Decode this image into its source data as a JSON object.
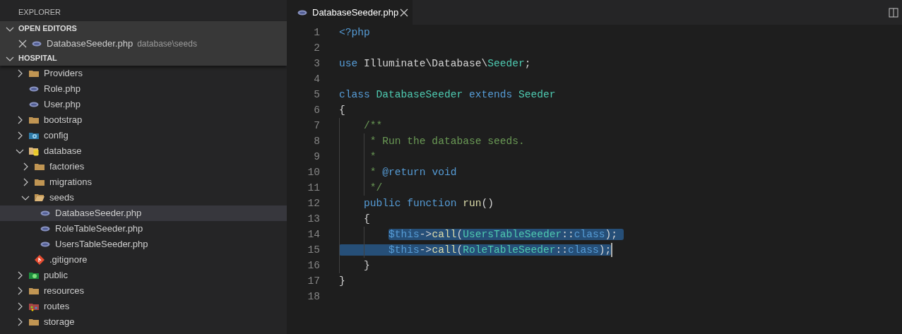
{
  "sidebar": {
    "title": "EXPLORER",
    "sections": [
      {
        "title": "OPEN EDITORS",
        "expanded": true,
        "items": [
          {
            "name": "DatabaseSeeder.php",
            "path": "database\\seeds",
            "kind": "php-file"
          }
        ]
      },
      {
        "title": "HOSPITAL",
        "expanded": true
      }
    ],
    "tree": [
      {
        "children": [
          {
            "label": "Providers",
            "kind": "folder",
            "expanded": false,
            "selected": false
          },
          {
            "label": "Role.php",
            "kind": "php-file",
            "selected": false
          },
          {
            "label": "User.php",
            "kind": "php-file",
            "selected": false
          }
        ]
      },
      {
        "label": "bootstrap",
        "kind": "folder",
        "expanded": false,
        "selected": false
      },
      {
        "label": "config",
        "kind": "config-folder",
        "expanded": false,
        "selected": false
      },
      {
        "label": "database",
        "kind": "database-folder",
        "expanded": true,
        "selected": false,
        "children": [
          {
            "label": "factories",
            "kind": "folder",
            "expanded": false,
            "selected": false
          },
          {
            "label": "migrations",
            "kind": "folder",
            "expanded": false,
            "selected": false
          },
          {
            "label": "seeds",
            "kind": "folder",
            "expanded": true,
            "selected": false,
            "children": [
              {
                "label": "DatabaseSeeder.php",
                "kind": "php-file",
                "selected": true
              },
              {
                "label": "RoleTableSeeder.php",
                "kind": "php-file",
                "selected": false
              },
              {
                "label": "UsersTableSeeder.php",
                "kind": "php-file",
                "selected": false
              }
            ]
          },
          {
            "label": ".gitignore",
            "kind": "git-file",
            "selected": false
          }
        ]
      },
      {
        "label": "public",
        "kind": "public-folder",
        "expanded": false,
        "selected": false
      },
      {
        "label": "resources",
        "kind": "folder",
        "expanded": false,
        "selected": false
      },
      {
        "label": "routes",
        "kind": "routes-folder",
        "expanded": false,
        "selected": false
      },
      {
        "label": "storage",
        "kind": "folder",
        "expanded": false,
        "selected": false
      }
    ]
  },
  "tabs": [
    {
      "label": "DatabaseSeeder.php",
      "kind": "php-file",
      "selected": true
    }
  ],
  "editor": {
    "lines": [
      {
        "number": "1",
        "selected": false,
        "cursor": false,
        "tokens": [
          {
            "t": "<?php",
            "kind": "keyword"
          }
        ]
      },
      {
        "number": "2",
        "selected": false,
        "cursor": false
      },
      {
        "number": "3",
        "selected": false,
        "cursor": false,
        "tokens": [
          {
            "t": "use",
            "kind": "keyword"
          },
          {
            "t": " Illuminate\\Database\\",
            "kind": "text"
          },
          {
            "t": "Seeder",
            "kind": "type"
          },
          {
            "t": ";",
            "kind": "text"
          }
        ]
      },
      {
        "number": "4",
        "selected": false,
        "cursor": false
      },
      {
        "number": "5",
        "selected": false,
        "cursor": false,
        "tokens": [
          {
            "t": "class",
            "kind": "keyword"
          },
          {
            "t": " DatabaseSeeder",
            "kind": "type"
          },
          {
            "t": " extends",
            "kind": "keyword"
          },
          {
            "t": " Seeder",
            "kind": "type"
          }
        ]
      },
      {
        "number": "6",
        "selected": false,
        "cursor": false,
        "tokens": [
          {
            "t": "{",
            "kind": "text"
          }
        ]
      },
      {
        "number": "7",
        "selected": false,
        "cursor": false,
        "tokens": [
          {
            "t": "    /**",
            "kind": "comment"
          }
        ]
      },
      {
        "number": "8",
        "selected": false,
        "cursor": false,
        "tokens": [
          {
            "t": "     * Run the database seeds.",
            "kind": "comment"
          }
        ]
      },
      {
        "number": "9",
        "selected": false,
        "cursor": false,
        "tokens": [
          {
            "t": "     *",
            "kind": "comment"
          }
        ]
      },
      {
        "number": "10",
        "selected": false,
        "cursor": false,
        "tokens": [
          {
            "t": "     *",
            "kind": "comment"
          },
          {
            "t": " @return void",
            "kind": "keyword"
          }
        ]
      },
      {
        "number": "11",
        "selected": false,
        "cursor": false,
        "tokens": [
          {
            "t": "     */",
            "kind": "comment"
          }
        ]
      },
      {
        "number": "12",
        "selected": false,
        "cursor": false,
        "tokens": [
          {
            "t": "    public function",
            "kind": "keyword"
          },
          {
            "t": " run",
            "kind": "function"
          },
          {
            "t": "()",
            "kind": "text"
          }
        ]
      },
      {
        "number": "13",
        "selected": false,
        "cursor": false,
        "tokens": [
          {
            "t": "    {",
            "kind": "text"
          }
        ]
      },
      {
        "number": "14",
        "selected": true,
        "cursor": false,
        "tokens": [
          {
            "t": "        $this",
            "kind": "variable"
          },
          {
            "t": "->",
            "kind": "text"
          },
          {
            "t": "call",
            "kind": "function"
          },
          {
            "t": "(",
            "kind": "text"
          },
          {
            "t": "UsersTableSeeder",
            "kind": "type"
          },
          {
            "t": "::",
            "kind": "text"
          },
          {
            "t": "class",
            "kind": "keyword"
          },
          {
            "t": ");",
            "kind": "text"
          }
        ]
      },
      {
        "number": "15",
        "selected": true,
        "cursor": true,
        "tokens": [
          {
            "t": "        $this",
            "kind": "variable"
          },
          {
            "t": "->",
            "kind": "text"
          },
          {
            "t": "call",
            "kind": "function"
          },
          {
            "t": "(",
            "kind": "text"
          },
          {
            "t": "RoleTableSeeder",
            "kind": "type"
          },
          {
            "t": "::",
            "kind": "text"
          },
          {
            "t": "class",
            "kind": "keyword"
          },
          {
            "t": ");",
            "kind": "text"
          }
        ]
      },
      {
        "number": "16",
        "selected": false,
        "cursor": false,
        "tokens": [
          {
            "t": "    }",
            "kind": "text"
          }
        ]
      },
      {
        "number": "17",
        "selected": false,
        "cursor": false,
        "tokens": [
          {
            "t": "}",
            "kind": "text"
          }
        ]
      },
      {
        "number": "18",
        "selected": false,
        "cursor": false
      }
    ]
  }
}
